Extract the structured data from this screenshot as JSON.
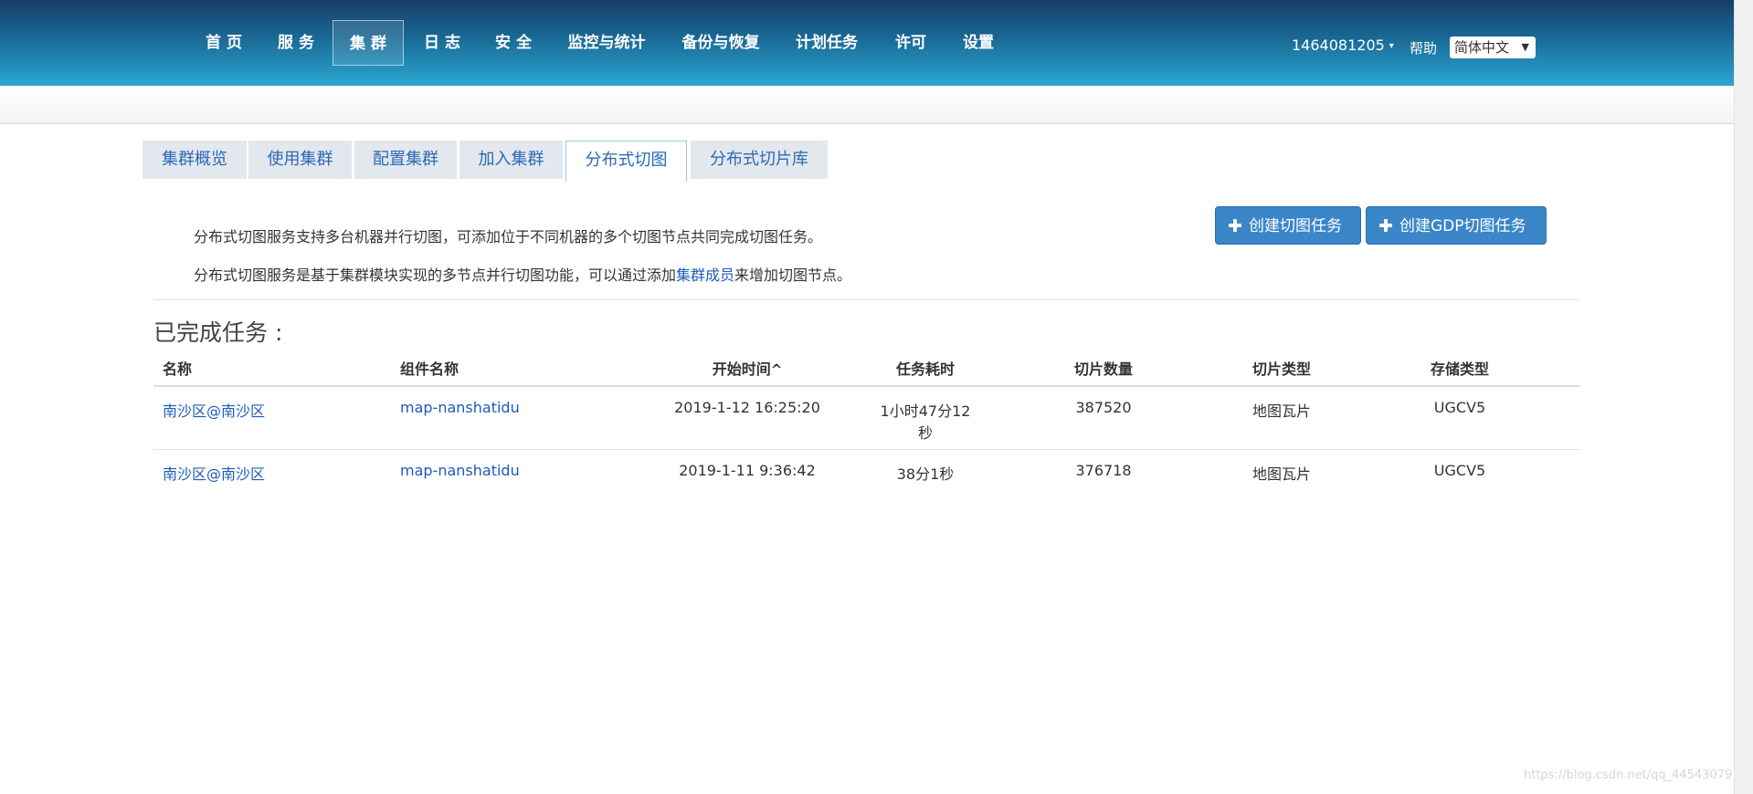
{
  "nav": {
    "items": [
      "首 页",
      "服 务",
      "集 群",
      "日 志",
      "安 全",
      "监控与统计",
      "备份与恢复",
      "计划任务",
      "许可",
      "设置"
    ],
    "user": "1464081205",
    "help": "帮助",
    "language": "简体中文"
  },
  "tabs": [
    "集群概览",
    "使用集群",
    "配置集群",
    "加入集群",
    "分布式切图",
    "分布式切片库"
  ],
  "intro": {
    "line1": "分布式切图服务支持多台机器并行切图，可添加位于不同机器的多个切图节点共同完成切图任务。",
    "line2_prefix": "分布式切图服务是基于集群模块实现的多节点并行切图功能，可以通过添加",
    "line2_link": "集群成员",
    "line2_suffix": "来增加切图节点。"
  },
  "buttons": {
    "create_task": "创建切图任务",
    "create_gdp_task": "创建GDP切图任务"
  },
  "completed": {
    "title": "已完成任务 :",
    "columns": [
      "名称",
      "组件名称",
      "开始时间",
      "任务耗时",
      "切片数量",
      "切片类型",
      "存储类型"
    ],
    "rows": [
      {
        "name": "南沙区@南沙区",
        "component": "map-nanshatidu",
        "start": "2019-1-12 16:25:20",
        "duration_l1": "1小时47分12",
        "duration_l2": "秒",
        "count": "387520",
        "tile_type": "地图瓦片",
        "storage": "UGCV5"
      },
      {
        "name": "南沙区@南沙区",
        "component": "map-nanshatidu",
        "start": "2019-1-11 9:36:42",
        "duration_l1": "38分1秒",
        "duration_l2": "",
        "count": "376718",
        "tile_type": "地图瓦片",
        "storage": "UGCV5"
      }
    ]
  },
  "watermark": "https://blog.csdn.net/qq_44543079",
  "colors": {
    "nav_top": "#173d69",
    "nav_bottom": "#2aa7d3",
    "link": "#1e5bb8",
    "button": "#3a86c8",
    "tab_bg": "#e3e7ee"
  }
}
